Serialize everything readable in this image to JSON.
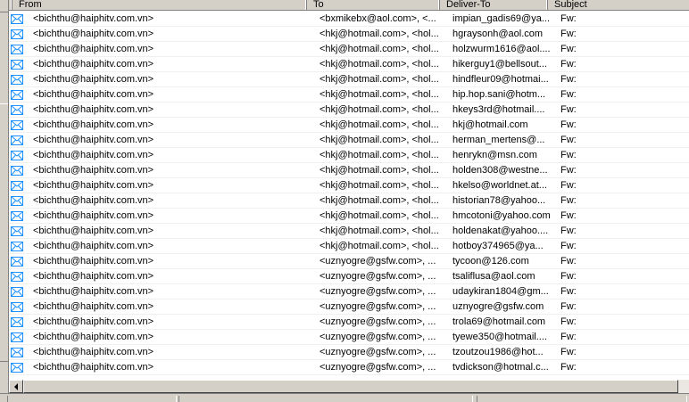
{
  "columns": {
    "from": "From",
    "to": "To",
    "deliver_to": "Deliver-To",
    "subject": "Subject"
  },
  "icon": "envelope-icon",
  "accent_color": "#1e90ff",
  "rows": [
    {
      "from": "<bichthu@haiphitv.com.vn>",
      "to": "<bxmikebx@aol.com>, <...",
      "deliver_to": "impian_gadis69@ya...",
      "subject": "Fw:"
    },
    {
      "from": "<bichthu@haiphitv.com.vn>",
      "to": "<hkj@hotmail.com>, <hol...",
      "deliver_to": "hgraysonh@aol.com",
      "subject": "Fw:"
    },
    {
      "from": "<bichthu@haiphitv.com.vn>",
      "to": "<hkj@hotmail.com>, <hol...",
      "deliver_to": "holzwurm1616@aol....",
      "subject": "Fw:"
    },
    {
      "from": "<bichthu@haiphitv.com.vn>",
      "to": "<hkj@hotmail.com>, <hol...",
      "deliver_to": "hikerguy1@bellsout...",
      "subject": "Fw:"
    },
    {
      "from": "<bichthu@haiphitv.com.vn>",
      "to": "<hkj@hotmail.com>, <hol...",
      "deliver_to": "hindfleur09@hotmai...",
      "subject": "Fw:"
    },
    {
      "from": "<bichthu@haiphitv.com.vn>",
      "to": "<hkj@hotmail.com>, <hol...",
      "deliver_to": "hip.hop.sani@hotm...",
      "subject": "Fw:"
    },
    {
      "from": "<bichthu@haiphitv.com.vn>",
      "to": "<hkj@hotmail.com>, <hol...",
      "deliver_to": "hkeys3rd@hotmail....",
      "subject": "Fw:"
    },
    {
      "from": "<bichthu@haiphitv.com.vn>",
      "to": "<hkj@hotmail.com>, <hol...",
      "deliver_to": "hkj@hotmail.com",
      "subject": "Fw:"
    },
    {
      "from": "<bichthu@haiphitv.com.vn>",
      "to": "<hkj@hotmail.com>, <hol...",
      "deliver_to": "herman_mertens@...",
      "subject": "Fw:"
    },
    {
      "from": "<bichthu@haiphitv.com.vn>",
      "to": "<hkj@hotmail.com>, <hol...",
      "deliver_to": "henrykn@msn.com",
      "subject": "Fw:"
    },
    {
      "from": "<bichthu@haiphitv.com.vn>",
      "to": "<hkj@hotmail.com>, <hol...",
      "deliver_to": "holden308@westne...",
      "subject": "Fw:"
    },
    {
      "from": "<bichthu@haiphitv.com.vn>",
      "to": "<hkj@hotmail.com>, <hol...",
      "deliver_to": "hkelso@worldnet.at...",
      "subject": "Fw:"
    },
    {
      "from": "<bichthu@haiphitv.com.vn>",
      "to": "<hkj@hotmail.com>, <hol...",
      "deliver_to": "historian78@yahoo...",
      "subject": "Fw:"
    },
    {
      "from": "<bichthu@haiphitv.com.vn>",
      "to": "<hkj@hotmail.com>, <hol...",
      "deliver_to": "hmcotoni@yahoo.com",
      "subject": "Fw:"
    },
    {
      "from": "<bichthu@haiphitv.com.vn>",
      "to": "<hkj@hotmail.com>, <hol...",
      "deliver_to": "holdenakat@yahoo....",
      "subject": "Fw:"
    },
    {
      "from": "<bichthu@haiphitv.com.vn>",
      "to": "<hkj@hotmail.com>, <hol...",
      "deliver_to": "hotboy374965@ya...",
      "subject": "Fw:"
    },
    {
      "from": "<bichthu@haiphitv.com.vn>",
      "to": "<uznyogre@gsfw.com>, ...",
      "deliver_to": "tycoon@126.com",
      "subject": "Fw:"
    },
    {
      "from": "<bichthu@haiphitv.com.vn>",
      "to": "<uznyogre@gsfw.com>, ...",
      "deliver_to": "tsaliflusa@aol.com",
      "subject": "Fw:"
    },
    {
      "from": "<bichthu@haiphitv.com.vn>",
      "to": "<uznyogre@gsfw.com>, ...",
      "deliver_to": "udaykiran1804@gm...",
      "subject": "Fw:"
    },
    {
      "from": "<bichthu@haiphitv.com.vn>",
      "to": "<uznyogre@gsfw.com>, ...",
      "deliver_to": "uznyogre@gsfw.com",
      "subject": "Fw:"
    },
    {
      "from": "<bichthu@haiphitv.com.vn>",
      "to": "<uznyogre@gsfw.com>, ...",
      "deliver_to": "trola69@hotmail.com",
      "subject": "Fw:"
    },
    {
      "from": "<bichthu@haiphitv.com.vn>",
      "to": "<uznyogre@gsfw.com>, ...",
      "deliver_to": "tyewe350@hotmail....",
      "subject": "Fw:"
    },
    {
      "from": "<bichthu@haiphitv.com.vn>",
      "to": "<uznyogre@gsfw.com>, ...",
      "deliver_to": "tzoutzou1986@hot...",
      "subject": "Fw:"
    },
    {
      "from": "<bichthu@haiphitv.com.vn>",
      "to": "<uznyogre@gsfw.com>, ...",
      "deliver_to": "tvdickson@hotmal.c...",
      "subject": "Fw:"
    }
  ]
}
